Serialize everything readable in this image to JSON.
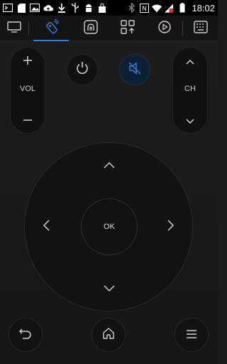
{
  "status_bar": {
    "time": "18:02",
    "left_icons": [
      "terminal-icon",
      "sd-card-icon",
      "image-icon",
      "cloud-upload-icon",
      "download-icon",
      "usb-icon",
      "android-icon",
      "shopping-bag-icon"
    ],
    "right_icons": [
      "bluetooth-icon",
      "nfc-icon",
      "wifi-icon",
      "signal-icon",
      "battery-icon"
    ]
  },
  "tabs": [
    {
      "name": "tv-icon",
      "active": false
    },
    {
      "name": "remote-icon",
      "active": true
    },
    {
      "name": "touchpad-icon",
      "active": false
    },
    {
      "name": "apps-icon",
      "active": false
    },
    {
      "name": "play-icon",
      "active": false
    },
    {
      "name": "keyboard-icon",
      "active": false
    }
  ],
  "remote": {
    "vol_label": "VOL",
    "ch_label": "CH",
    "ok_label": "OK"
  },
  "colors": {
    "accent": "#2b7fd9",
    "mute_bg": "#0d1f33",
    "icon": "#cfcfcf"
  }
}
